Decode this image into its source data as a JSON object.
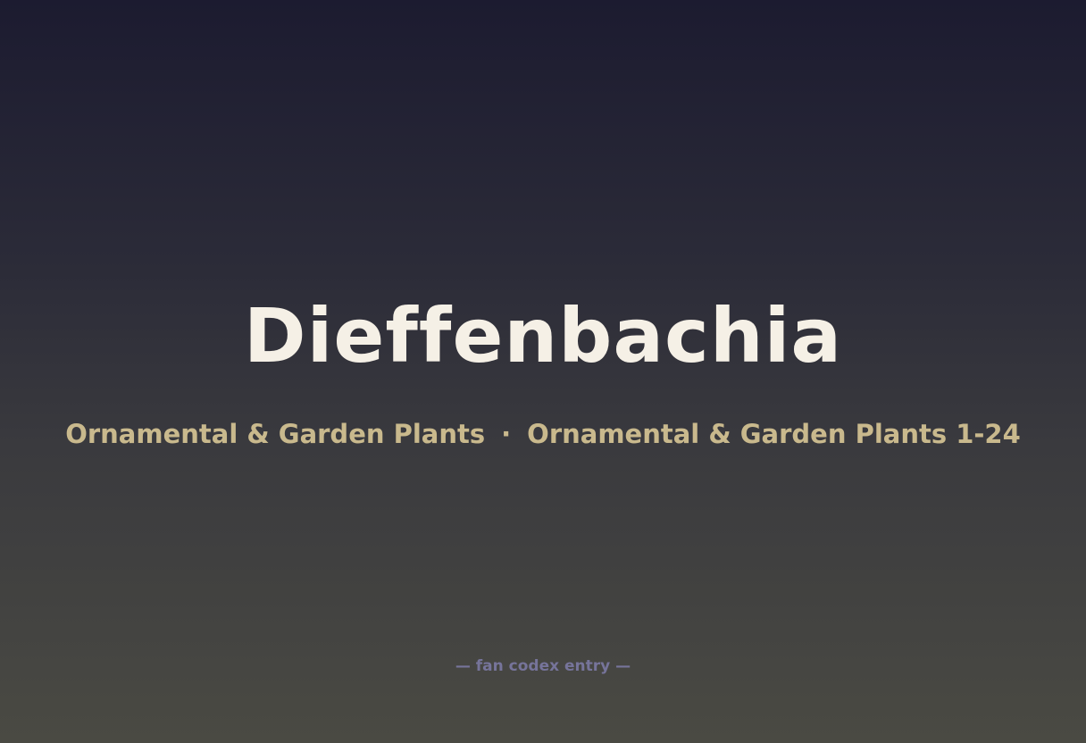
{
  "title": "Dieffenbachia",
  "subtitle": {
    "left": "Ornamental & Garden Plants",
    "separator": "·",
    "right": "Ornamental & Garden Plants 1-24"
  },
  "footer": "— fan codex entry —",
  "colors": {
    "title": "#f5f0e6",
    "subtitle": "#c9b98d",
    "footer": "#76749a",
    "background_top": "#1c1b30",
    "background_bottom": "#4a4a43"
  }
}
